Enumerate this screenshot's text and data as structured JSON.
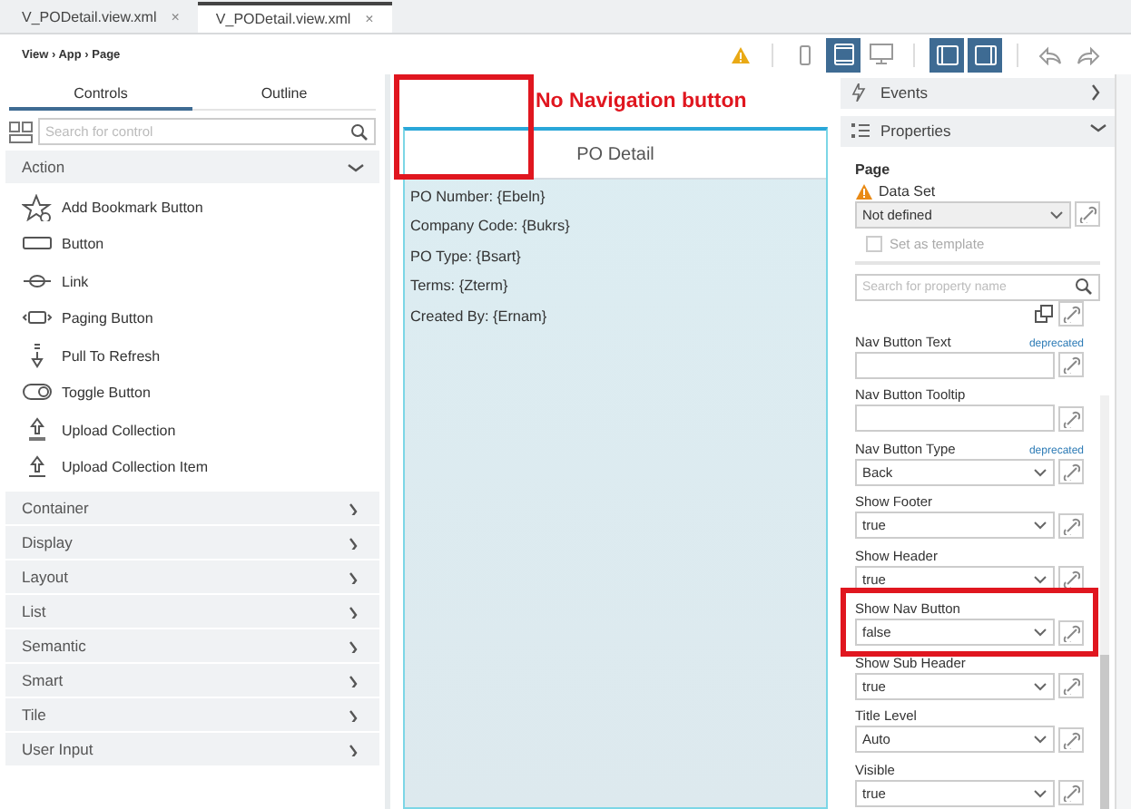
{
  "editor_tabs": [
    {
      "label": "V_PODetail.view.xml",
      "close": "×",
      "selected": false
    },
    {
      "label": "V_PODetail.view.xml",
      "close": "×",
      "selected": true
    }
  ],
  "breadcrumb": "View › App › Page",
  "toolbar": [
    {
      "kind": "warning",
      "selected": false
    },
    {
      "kind": "phone",
      "selected": false
    },
    {
      "kind": "tablet",
      "selected": true
    },
    {
      "kind": "desktop",
      "selected": false
    },
    {
      "kind": "left-pane",
      "selected": true
    },
    {
      "kind": "right-pane",
      "selected": true
    },
    {
      "kind": "undo",
      "selected": false
    },
    {
      "kind": "redo",
      "selected": false
    }
  ],
  "palette": {
    "tabs": [
      {
        "label": "Controls",
        "selected": true
      },
      {
        "label": "Outline",
        "selected": false
      }
    ],
    "search": {
      "placeholder": "Search for control"
    },
    "groups": [
      {
        "label": "Action",
        "expanded": true,
        "items": [
          {
            "label": "Add Bookmark Button",
            "kind": "bookmark"
          },
          {
            "label": "Button",
            "kind": "button"
          },
          {
            "label": "Link",
            "kind": "link"
          },
          {
            "label": "Paging Button",
            "kind": "paging"
          },
          {
            "label": "Pull To Refresh",
            "kind": "pull"
          },
          {
            "label": "Toggle Button",
            "kind": "toggle"
          },
          {
            "label": "Upload Collection",
            "kind": "upload"
          },
          {
            "label": "Upload Collection Item",
            "kind": "upload-item"
          }
        ]
      },
      {
        "label": "Container",
        "expanded": false
      },
      {
        "label": "Display",
        "expanded": false
      },
      {
        "label": "Layout",
        "expanded": false
      },
      {
        "label": "List",
        "expanded": false
      },
      {
        "label": "Semantic",
        "expanded": false
      },
      {
        "label": "Smart",
        "expanded": false
      },
      {
        "label": "Tile",
        "expanded": false
      },
      {
        "label": "User Input",
        "expanded": false
      }
    ]
  },
  "annotation": {
    "text": "No Navigation button"
  },
  "preview": {
    "title": "PO Detail",
    "lines": [
      "PO Number: {Ebeln}",
      "Company Code: {Bukrs}",
      "PO Type: {Bsart}",
      "Terms: {Zterm}",
      "Created By: {Ernam}"
    ]
  },
  "properties_panel": {
    "sections": [
      {
        "label": "Events",
        "expanded": false
      },
      {
        "label": "Properties",
        "expanded": true
      }
    ],
    "heading": "Page",
    "data_set": {
      "label": "Data Set",
      "value": "Not defined"
    },
    "template": {
      "label": "Set as template",
      "checked": false,
      "disabled": true
    },
    "search": {
      "placeholder": "Search for property name"
    },
    "properties": [
      {
        "label": "Nav Button Text",
        "badge": "deprecated",
        "kind": "text",
        "highlighted": false
      },
      {
        "label": "Nav Button Tooltip",
        "kind": "text",
        "highlighted": false
      },
      {
        "label": "Nav Button Type",
        "badge": "deprecated",
        "kind": "select",
        "value": "Back",
        "highlighted": false
      },
      {
        "label": "Show Footer",
        "kind": "select",
        "value": "true",
        "highlighted": false
      },
      {
        "label": "Show Header",
        "kind": "select",
        "value": "true",
        "highlighted": false
      },
      {
        "label": "Show Nav Button",
        "kind": "select",
        "value": "false",
        "highlighted": true
      },
      {
        "label": "Show Sub Header",
        "kind": "select",
        "value": "true",
        "highlighted": false
      },
      {
        "label": "Title Level",
        "kind": "select",
        "value": "Auto",
        "highlighted": false
      },
      {
        "label": "Visible",
        "kind": "select",
        "value": "true",
        "highlighted": false
      }
    ]
  }
}
